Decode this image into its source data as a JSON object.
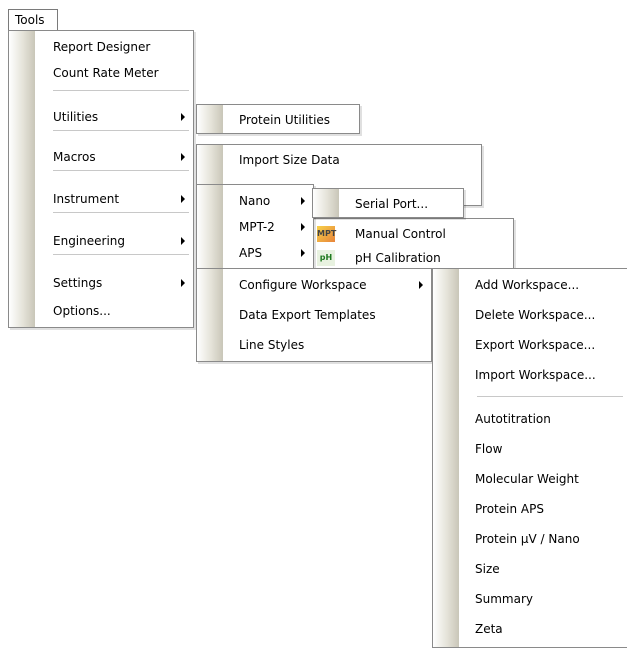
{
  "menubar": {
    "tools_label": "Tools"
  },
  "tools_menu": {
    "items": [
      {
        "label": "Report Designer"
      },
      {
        "label": "Count Rate Meter"
      },
      {
        "label": "Utilities"
      },
      {
        "label": "Macros"
      },
      {
        "label": "Instrument"
      },
      {
        "label": "Engineering"
      },
      {
        "label": "Settings"
      },
      {
        "label": "Options..."
      }
    ]
  },
  "utilities_menu": {
    "items": [
      {
        "label": "Protein Utilities"
      }
    ]
  },
  "macros_menu": {
    "items": [
      {
        "label": "Import Size Data"
      }
    ]
  },
  "instrument_menu": {
    "items": [
      {
        "label": "Nano"
      },
      {
        "label": "MPT-2"
      },
      {
        "label": "APS"
      }
    ]
  },
  "nano_menu": {
    "items": [
      {
        "label": "Serial Port..."
      }
    ]
  },
  "mpt2_menu": {
    "items": [
      {
        "label": "Manual Control",
        "icon": "MPT"
      },
      {
        "label": "pH Calibration",
        "icon": "pH"
      }
    ]
  },
  "settings_menu": {
    "items": [
      {
        "label": "Configure Workspace"
      },
      {
        "label": "Data Export Templates"
      },
      {
        "label": "Line Styles"
      }
    ]
  },
  "workspace_menu": {
    "items": [
      {
        "label": "Add Workspace..."
      },
      {
        "label": "Delete Workspace..."
      },
      {
        "label": "Export Workspace..."
      },
      {
        "label": "Import Workspace..."
      },
      {
        "label": "Autotitration"
      },
      {
        "label": "Flow"
      },
      {
        "label": "Molecular Weight"
      },
      {
        "label": "Protein APS"
      },
      {
        "label": "Protein µV / Nano"
      },
      {
        "label": "Size"
      },
      {
        "label": "Summary"
      },
      {
        "label": "Zeta"
      }
    ]
  }
}
